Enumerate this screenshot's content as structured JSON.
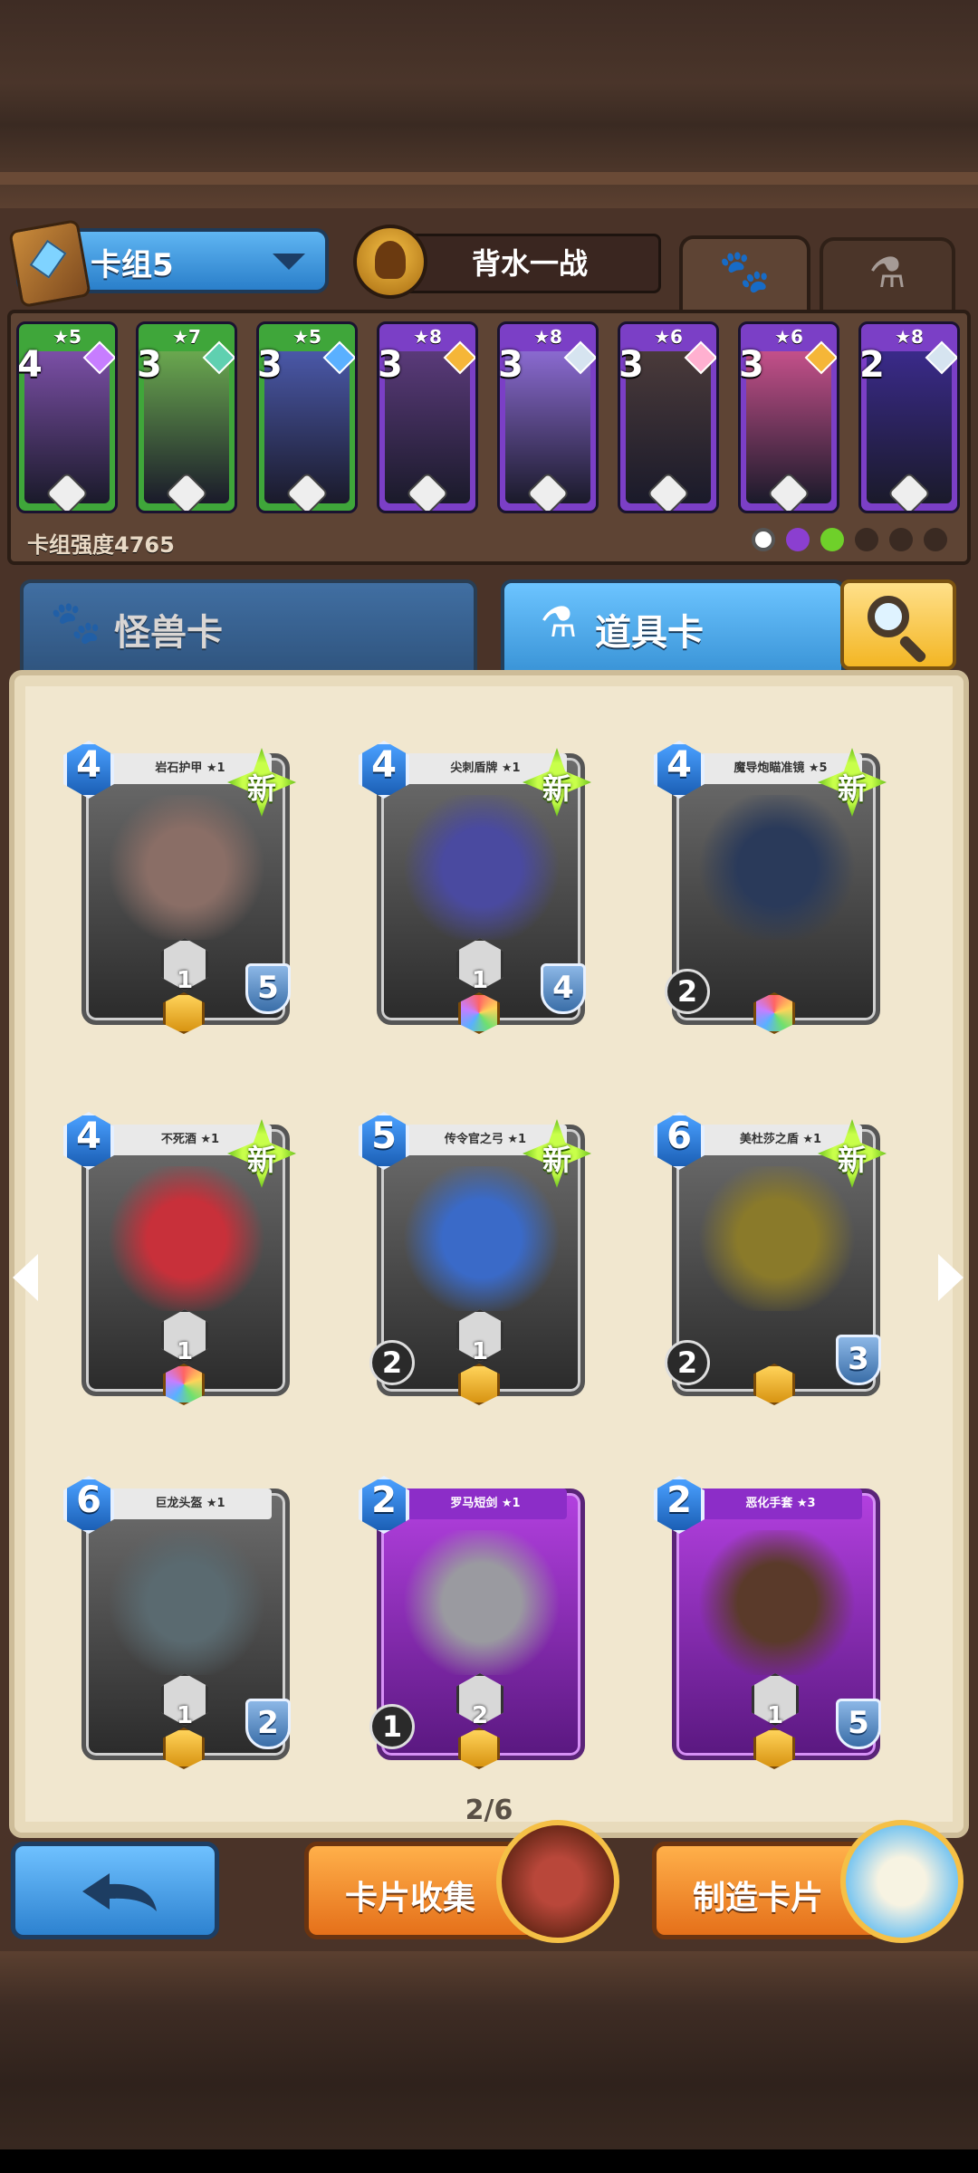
{
  "header": {
    "deck_name": "卡组5",
    "hero_name": "背水一战",
    "deck_power": "卡组强度4765"
  },
  "deck_cards": [
    {
      "cost": "4",
      "stars": "★5",
      "frame": "#3fa63a",
      "art": "#7b4fa6",
      "gem": "#c77dff"
    },
    {
      "cost": "3",
      "stars": "★7",
      "frame": "#3fa63a",
      "art": "#6aa84f",
      "gem": "#5fd0b0"
    },
    {
      "cost": "3",
      "stars": "★5",
      "frame": "#3fa63a",
      "art": "#4a58a8",
      "gem": "#5ab0ff"
    },
    {
      "cost": "3",
      "stars": "★8",
      "frame": "#7b3fc6",
      "art": "#5a3a7a",
      "gem": "#f5b638"
    },
    {
      "cost": "3",
      "stars": "★8",
      "frame": "#7b3fc6",
      "art": "#8a6ad0",
      "gem": "#d6e4f0"
    },
    {
      "cost": "3",
      "stars": "★6",
      "frame": "#7b3fc6",
      "art": "#4a3a3a",
      "gem": "#ffb0d0"
    },
    {
      "cost": "3",
      "stars": "★6",
      "frame": "#7b3fc6",
      "art": "#c4508a",
      "gem": "#f5b638"
    },
    {
      "cost": "2",
      "stars": "★8",
      "frame": "#7b3fc6",
      "art": "#3a2a8a",
      "gem": "#d6e4f0"
    }
  ],
  "tabs": {
    "monster": "怪兽卡",
    "item": "道具卡"
  },
  "cards": [
    {
      "cost": "4",
      "title": "岩石护甲 ★1",
      "new": "新",
      "ability": "1",
      "shield": "5",
      "atk": "",
      "rarity": "gold",
      "art": "#8a6e66"
    },
    {
      "cost": "4",
      "title": "尖刺盾牌 ★1",
      "new": "新",
      "ability": "1",
      "shield": "4",
      "atk": "",
      "rarity": "rainbow",
      "art": "#4a4aa0"
    },
    {
      "cost": "4",
      "title": "魔导炮瞄准镜 ★5",
      "new": "新",
      "ability": "",
      "shield": "",
      "atk": "2",
      "rarity": "rainbow",
      "art": "#2a3a5a"
    },
    {
      "cost": "4",
      "title": "不死酒 ★1",
      "new": "新",
      "ability": "1",
      "shield": "",
      "atk": "",
      "rarity": "rainbow",
      "art": "#c8303a"
    },
    {
      "cost": "5",
      "title": "传令官之弓 ★1",
      "new": "新",
      "ability": "1",
      "shield": "",
      "atk": "2",
      "rarity": "gold",
      "art": "#3a6ac8"
    },
    {
      "cost": "6",
      "title": "美杜莎之盾 ★1",
      "new": "新",
      "ability": "",
      "shield": "3",
      "atk": "2",
      "rarity": "gold",
      "art": "#8a7a2a"
    },
    {
      "cost": "6",
      "title": "巨龙头盔 ★1",
      "new": "",
      "ability": "1",
      "shield": "2",
      "atk": "",
      "rarity": "gold",
      "art": "#5a6a70"
    },
    {
      "cost": "2",
      "title": "罗马短剑 ★1",
      "new": "",
      "ability": "2",
      "shield": "",
      "atk": "1",
      "rarity": "gold",
      "art": "#9a9aa0"
    },
    {
      "cost": "2",
      "title": "恶化手套 ★3",
      "new": "",
      "ability": "1",
      "shield": "5",
      "atk": "",
      "rarity": "gold",
      "art": "#5a3a2a"
    }
  ],
  "pagination": "2/6",
  "buttons": {
    "collect": "卡片收集",
    "craft": "制造卡片"
  },
  "colors": {
    "accent_blue": "#3b95d8",
    "accent_orange": "#e5701a",
    "new_badge": "#8fe02a",
    "parchment": "#f1e7cf"
  }
}
